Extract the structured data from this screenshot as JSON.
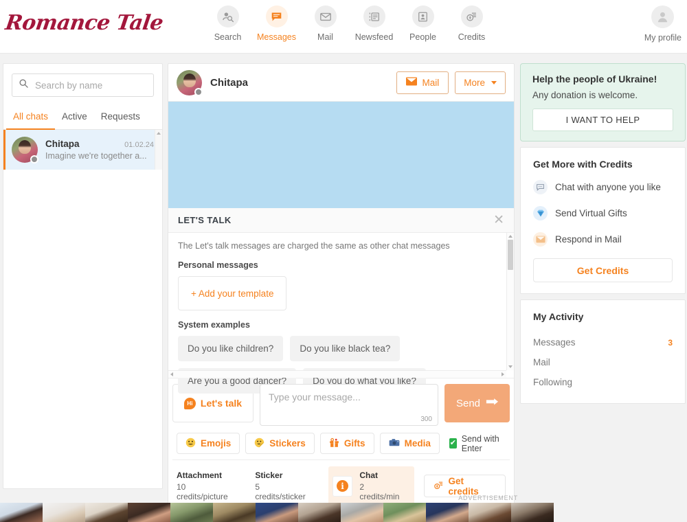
{
  "brand": {
    "logo": "Romance Tale"
  },
  "nav": {
    "items": [
      {
        "label": "Search",
        "icon": "user-search-icon",
        "active": false
      },
      {
        "label": "Messages",
        "icon": "chat-bubble-icon",
        "active": true
      },
      {
        "label": "Mail",
        "icon": "envelope-icon",
        "active": false
      },
      {
        "label": "Newsfeed",
        "icon": "newsfeed-icon",
        "active": false
      },
      {
        "label": "People",
        "icon": "person-card-icon",
        "active": false
      },
      {
        "label": "Credits",
        "icon": "credits-icon",
        "active": false
      }
    ],
    "profile": {
      "label": "My profile",
      "icon": "avatar-icon"
    }
  },
  "sidebar": {
    "search": {
      "placeholder": "Search by name",
      "value": ""
    },
    "tabs": [
      {
        "label": "All chats",
        "active": true
      },
      {
        "label": "Active",
        "active": false
      },
      {
        "label": "Requests",
        "active": false
      }
    ],
    "chats": [
      {
        "name": "Chitapa",
        "date": "01.02.24",
        "preview": "Imagine we're together a...",
        "status": "offline"
      }
    ]
  },
  "chat": {
    "header": {
      "name": "Chitapa",
      "mail_label": "Mail",
      "more_label": "More"
    },
    "messages": []
  },
  "lets_talk": {
    "title": "LET'S TALK",
    "close_icon": "✕",
    "note": "The Let's talk messages are charged the same as other chat messages",
    "personal_heading": "Personal messages",
    "add_template_label": "+ Add your template",
    "system_heading": "System examples",
    "examples": [
      "Do you like children?",
      "Do you like black tea?",
      "Are you a good dancer?",
      "Do you do what you like?"
    ]
  },
  "composer": {
    "lets_talk_label": "Let's talk",
    "hi_badge": "Hi",
    "input_placeholder": "Type your message...",
    "input_value": "",
    "char_count": "300",
    "send_label": "Send",
    "tools": [
      {
        "label": "Emojis",
        "icon": "smiley-icon"
      },
      {
        "label": "Stickers",
        "icon": "sticker-icon"
      },
      {
        "label": "Gifts",
        "icon": "gift-icon"
      },
      {
        "label": "Media",
        "icon": "camera-icon"
      }
    ],
    "send_with_enter": {
      "label": "Send with Enter",
      "checked": true,
      "check_glyph": "✔"
    }
  },
  "pricing": {
    "attachment": {
      "title": "Attachment",
      "value": "10 credits/picture"
    },
    "sticker": {
      "title": "Sticker",
      "value": "5 credits/sticker"
    },
    "chat": {
      "title": "Chat",
      "value": "2 credits/min",
      "icon": "info-icon",
      "info_glyph": "i"
    },
    "get_credits_label": "Get credits"
  },
  "rail": {
    "ukraine": {
      "title": "Help the people of Ukraine!",
      "subtitle": "Any donation is welcome.",
      "button": "I WANT TO HELP"
    },
    "credits": {
      "title": "Get More with Credits",
      "perks": [
        {
          "label": "Chat with anyone you like",
          "icon": "chat-bubble-icon",
          "color": "#e9eef5"
        },
        {
          "label": "Send Virtual Gifts",
          "icon": "diamond-icon",
          "color": "#e4f0fb"
        },
        {
          "label": "Respond in Mail",
          "icon": "envelope-icon",
          "color": "#fdeee0"
        }
      ],
      "button": "Get Credits"
    },
    "activity": {
      "title": "My Activity",
      "rows": [
        {
          "label": "Messages",
          "count": "3"
        },
        {
          "label": "Mail",
          "count": ""
        },
        {
          "label": "Following",
          "count": ""
        }
      ]
    }
  },
  "ad": {
    "label": "ADVERTISEMENT"
  },
  "colors": {
    "accent": "#f5821f",
    "brand": "#a3173c",
    "chat_bg": "#b6dcf2",
    "ukraine_bg": "#e6f4ec",
    "check_green": "#2bb24c"
  }
}
